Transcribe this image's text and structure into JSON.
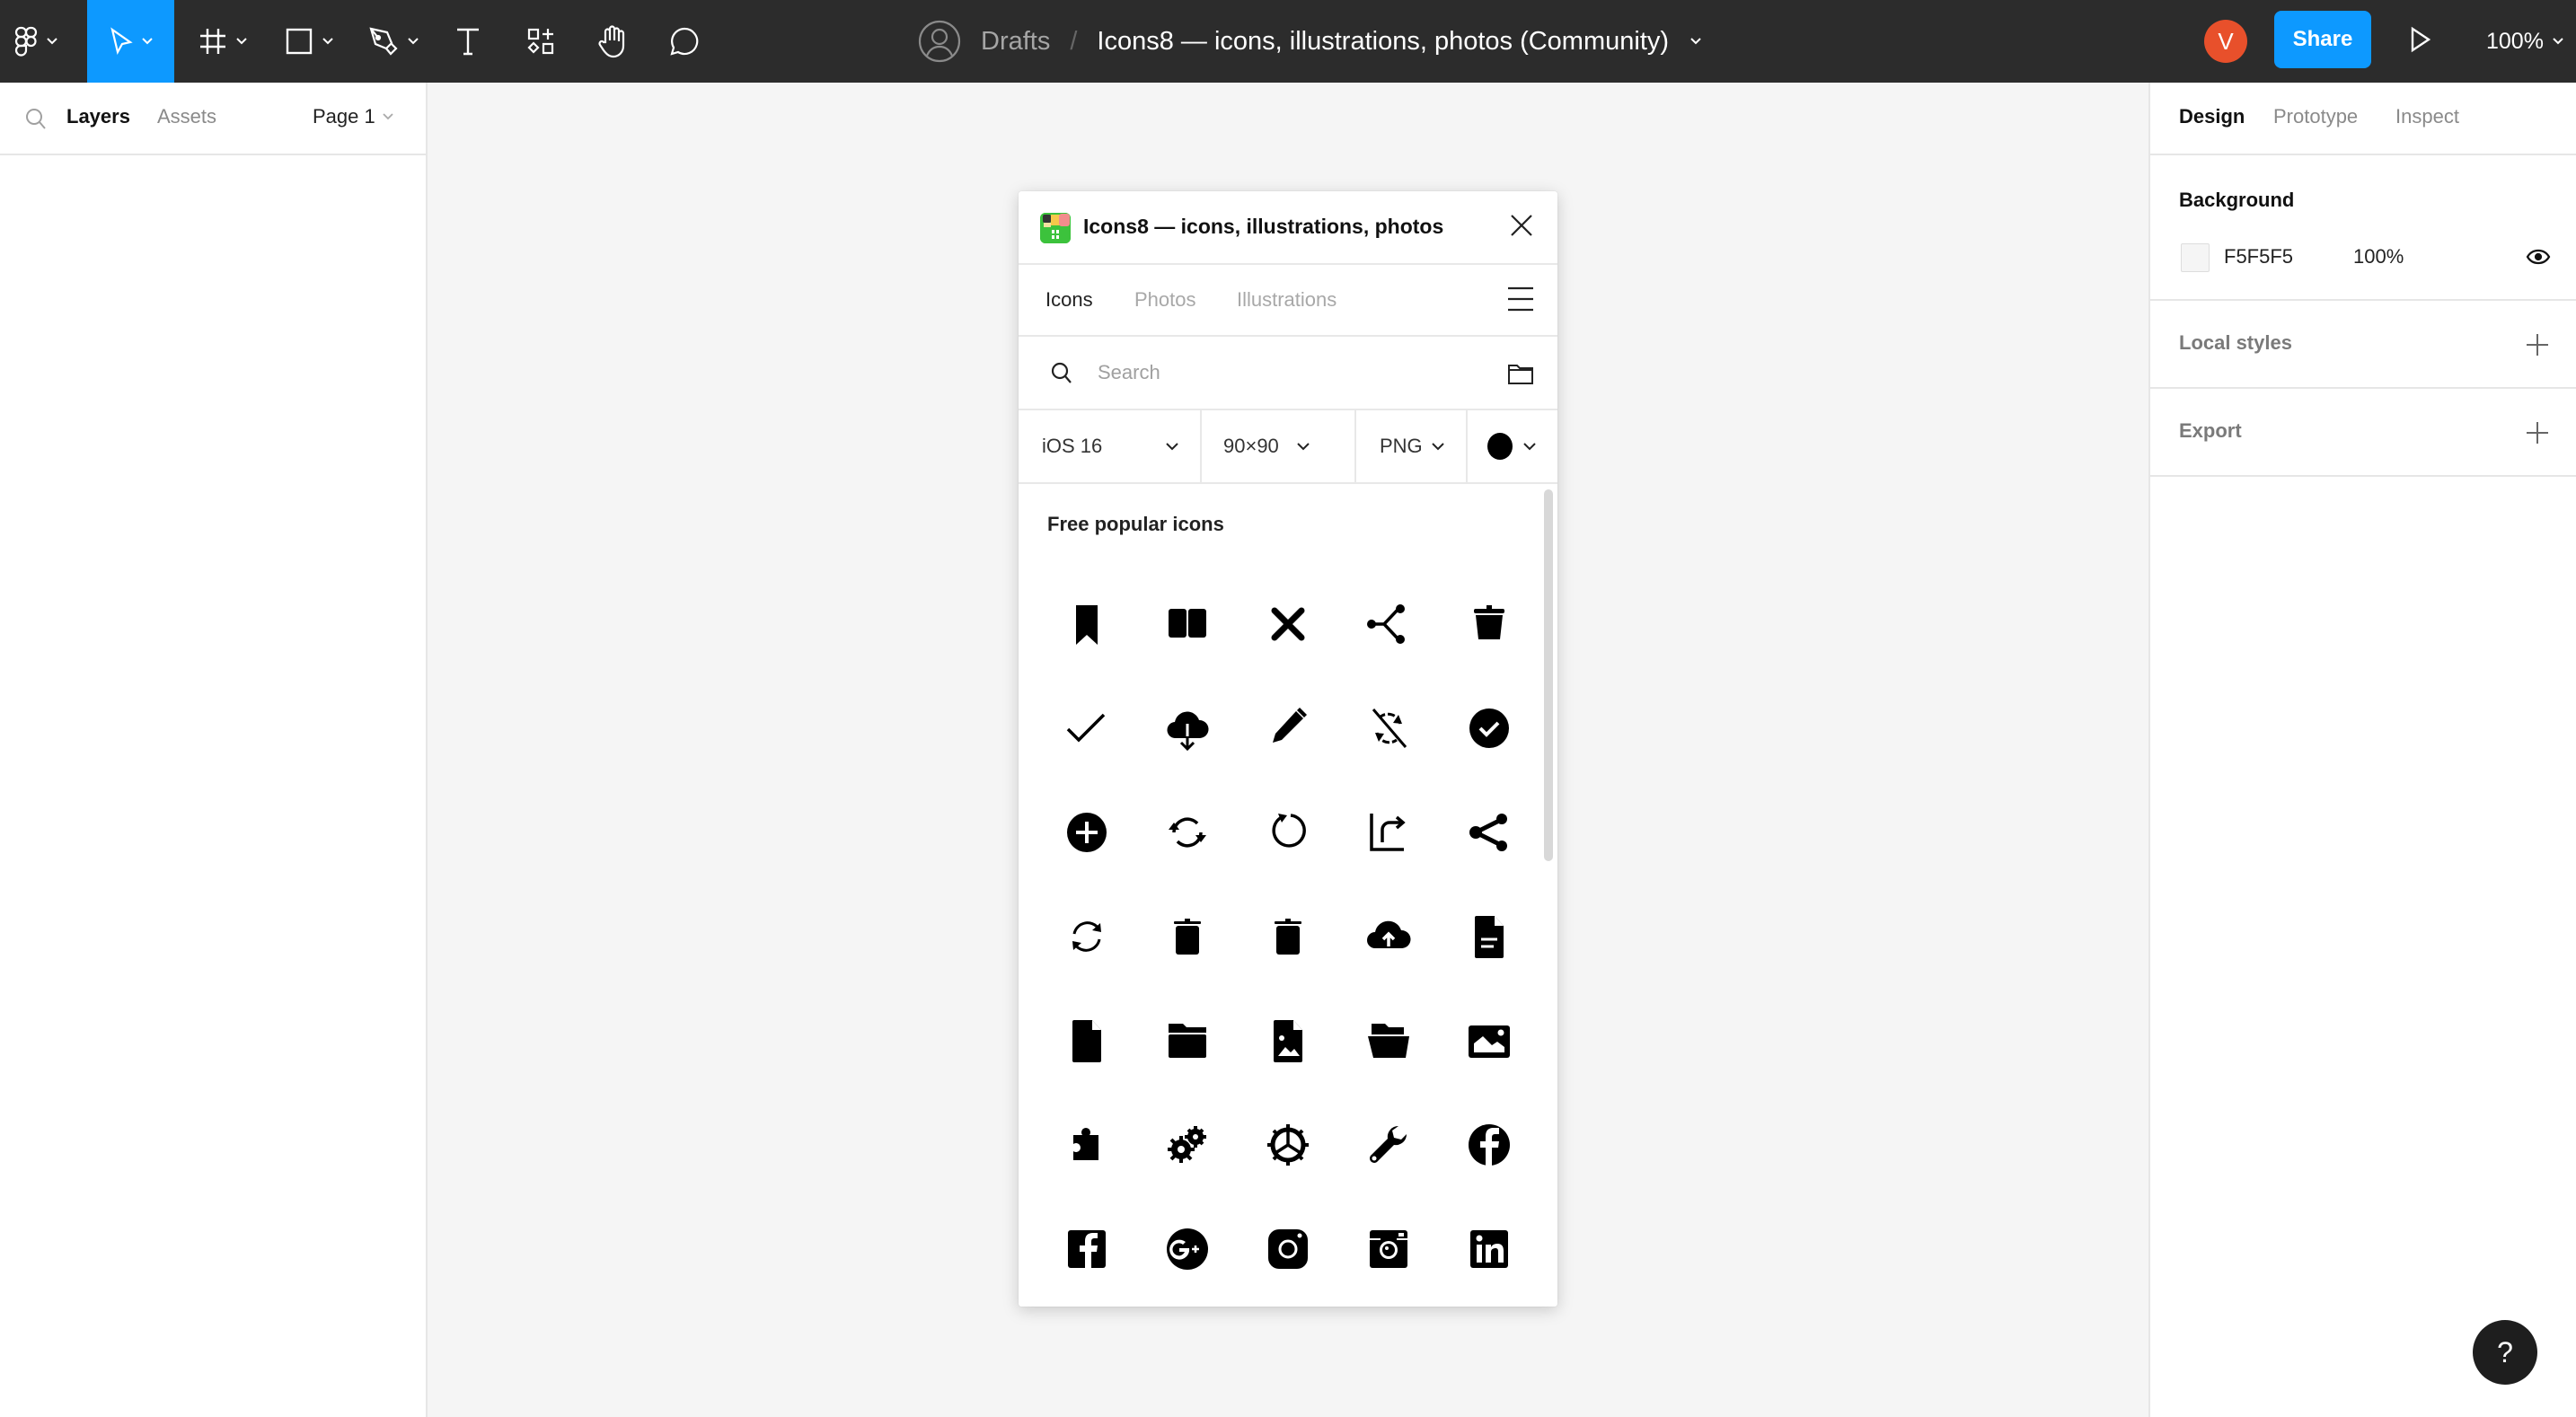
{
  "toolbar": {
    "tools": [
      {
        "id": "main-menu",
        "icon": "figma-logo-icon"
      },
      {
        "id": "move",
        "icon": "move-cursor-icon",
        "active": true
      },
      {
        "id": "frame",
        "icon": "frame-icon"
      },
      {
        "id": "shape",
        "icon": "rectangle-icon"
      },
      {
        "id": "pen",
        "icon": "pen-icon"
      },
      {
        "id": "text",
        "icon": "text-icon"
      },
      {
        "id": "resources",
        "icon": "resources-icon"
      },
      {
        "id": "hand",
        "icon": "hand-icon"
      },
      {
        "id": "comment",
        "icon": "comment-icon"
      }
    ],
    "breadcrumb": {
      "location": "Drafts",
      "separator": "/",
      "file_name": "Icons8 — icons, illustrations, photos (Community)"
    },
    "avatar_initial": "V",
    "avatar_color": "#E8502B",
    "share_label": "Share",
    "zoom_level": "100%",
    "accent_color": "#0D99FF"
  },
  "left_panel": {
    "tabs": [
      {
        "label": "Layers",
        "active": true
      },
      {
        "label": "Assets",
        "active": false
      }
    ],
    "page_selector": "Page 1"
  },
  "right_panel": {
    "tabs": [
      {
        "label": "Design",
        "active": true
      },
      {
        "label": "Prototype",
        "active": false
      },
      {
        "label": "Inspect",
        "active": false
      }
    ],
    "background": {
      "title": "Background",
      "hex": "F5F5F5",
      "opacity": "100%"
    },
    "local_styles_label": "Local styles",
    "export_label": "Export"
  },
  "plugin": {
    "title": "Icons8 — icons, illustrations, photos",
    "tabs": [
      {
        "label": "Icons",
        "active": true
      },
      {
        "label": "Photos",
        "active": false
      },
      {
        "label": "Illustrations",
        "active": false
      }
    ],
    "search": {
      "placeholder": "Search",
      "value": ""
    },
    "filters": {
      "style": "iOS 16",
      "size": "90×90",
      "format": "PNG",
      "color": "#000000"
    },
    "section_title": "Free popular icons",
    "icons": [
      "bookmark-icon",
      "open-book-icon",
      "delete-x-icon",
      "share-nodes-icon",
      "trash-can-icon",
      "checkmark-icon",
      "cloud-download-icon",
      "pencil-icon",
      "sync-disabled-icon",
      "checked-circle-icon",
      "add-circle-icon",
      "refresh-arrows-icon",
      "rotate-icon",
      "share-arrow-icon",
      "share-icon",
      "sync-icon",
      "trash-icon",
      "trash-alt-icon",
      "cloud-upload-icon",
      "document-icon",
      "file-icon",
      "folder-icon",
      "image-file-icon",
      "open-folder-icon",
      "image-icon",
      "puzzle-icon",
      "gears-icon",
      "settings-gear-icon",
      "wrench-icon",
      "facebook-circle-icon",
      "facebook-square-icon",
      "google-plus-icon",
      "instagram-icon",
      "instagram-old-icon",
      "linkedin-icon"
    ]
  },
  "help_label": "?"
}
